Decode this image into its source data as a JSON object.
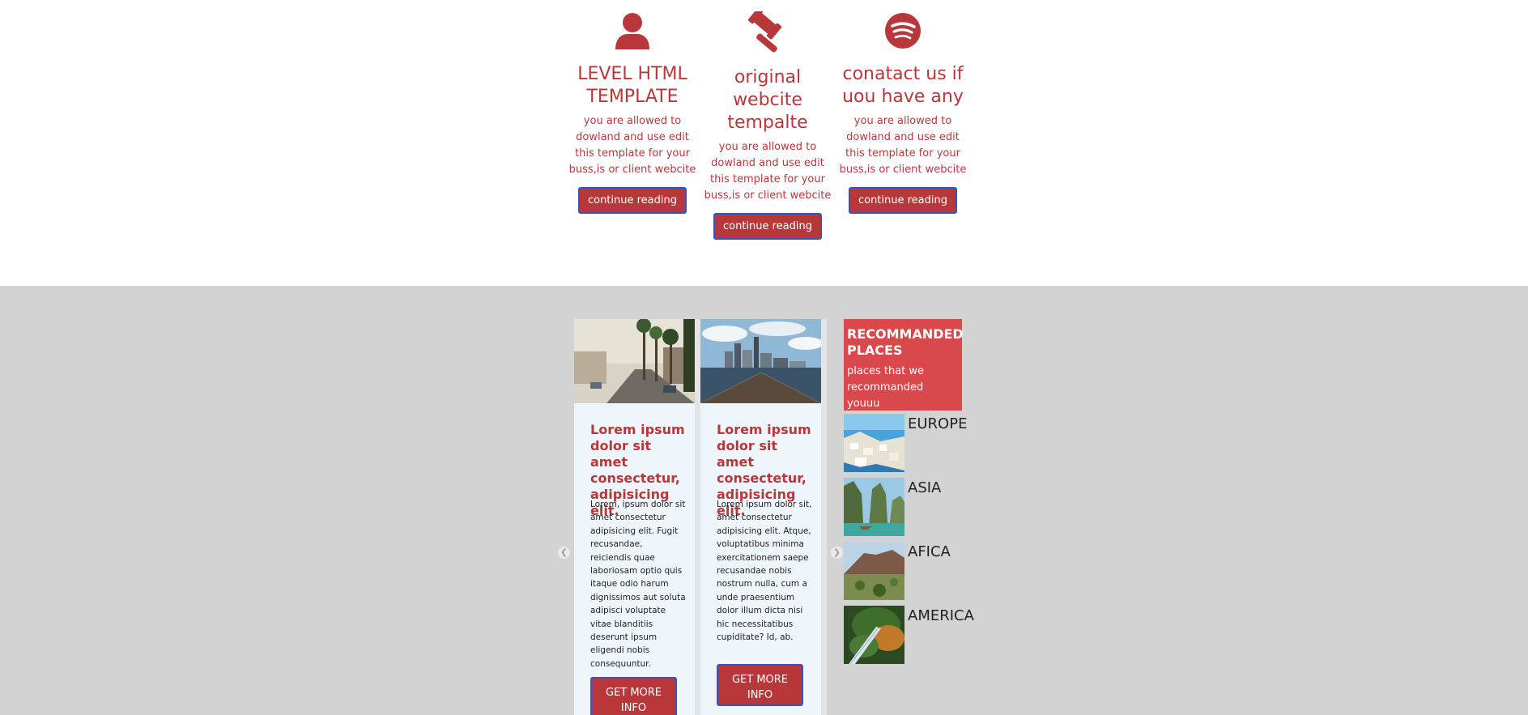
{
  "features": [
    {
      "icon": "user-icon",
      "title": "LEVEL HTML TEMPLATE",
      "text": "you are allowed to dowland and use edit this template for your buss,is or client webcite",
      "button": "continue reading"
    },
    {
      "icon": "gavel-icon",
      "title": "original webcite tempalte",
      "text": "you are allowed to dowland and use edit this template for your buss,is or client webcite",
      "button": "continue reading"
    },
    {
      "icon": "spotify-icon",
      "title": "conatact us if uou have any",
      "text": "you are allowed to dowland and use edit this template for your buss,is or client webcite",
      "button": "continue reading"
    }
  ],
  "cards": [
    {
      "image": "city-street-palm-trees-photo",
      "title": "Lorem ipsum dolor sit amet consectetur, adipisicing elit.",
      "text": "Lorem, ipsum dolor sit amet consectetur adipisicing elit. Fugit recusandae, reiciendis quae laboriosam optio quis itaque odio harum dignissimos aut soluta adipisci voluptate vitae blanditiis deserunt ipsum eligendi nobis consequuntur.",
      "button": "GET MORE INFO"
    },
    {
      "image": "city-skyline-bridge-photo",
      "title": "Lorem ipsum dolor sit amet consectetur, adipisicing elit.",
      "text": "Lorem ipsum dolor sit, amet consectetur adipisicing elit. Atque, voluptatibus minima exercitationem saepe recusandae nobis nostrum nulla, cum a unde praesentium dolor illum dicta nisi hic necessitatibus cupiditate? Id, ab.",
      "button": "GET MORE INFO"
    }
  ],
  "carousel": {
    "prev_icon": "chevron-left-icon",
    "next_icon": "chevron-right-icon"
  },
  "recommended": {
    "title": "RECOMMANDED PLACES",
    "subtitle": "places that we recommanded youuu",
    "places": [
      {
        "name": "EUROPE"
      },
      {
        "name": "ASIA"
      },
      {
        "name": "AFICA"
      },
      {
        "name": "AMERICA"
      }
    ]
  },
  "colors": {
    "accent": "#b7373a",
    "reco_bg": "#d9484b",
    "section_bg": "#d3d3d3",
    "card_bg": "#eef5fb",
    "button_border": "#3f51b5"
  }
}
